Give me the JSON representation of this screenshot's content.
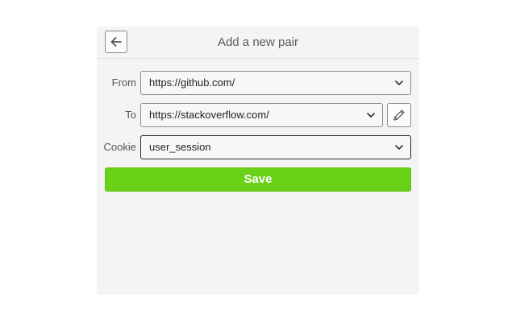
{
  "header": {
    "title": "Add a new pair",
    "back_icon": "arrow-left-icon"
  },
  "form": {
    "from": {
      "label": "From",
      "value": "https://github.com/"
    },
    "to": {
      "label": "To",
      "value": "https://stackoverflow.com/",
      "edit_icon": "pencil-icon"
    },
    "cookie": {
      "label": "Cookie",
      "value": "user_session"
    },
    "save_label": "Save"
  },
  "colors": {
    "save_button": "#69d118",
    "panel_background": "#f4f4f4"
  }
}
